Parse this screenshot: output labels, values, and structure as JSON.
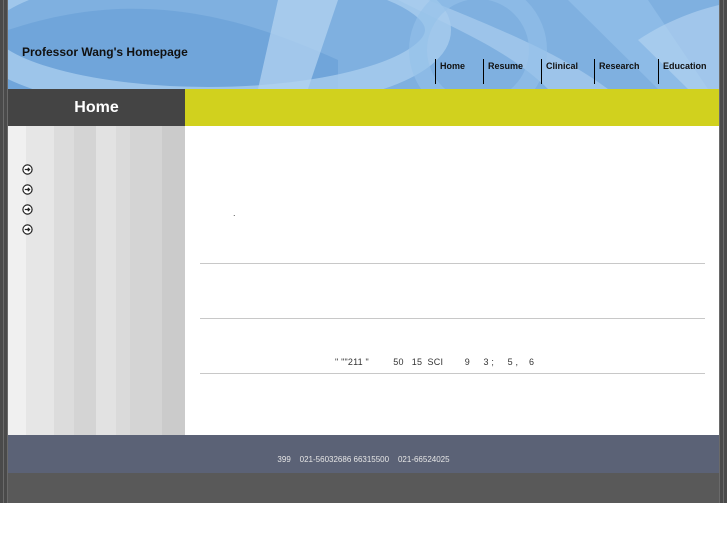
{
  "site": {
    "title": "Professor Wang's Homepage"
  },
  "nav": [
    {
      "label": "Home"
    },
    {
      "label": "Resume"
    },
    {
      "label": "Clinical"
    },
    {
      "label": "Research"
    },
    {
      "label": "Education"
    }
  ],
  "section": {
    "title": "Home"
  },
  "sidebar": {
    "link_count": 4,
    "icon": "circle-arrow-icon"
  },
  "main": {
    "dot": ".",
    "info_line": "\" \"\"211 \"         50   15  SCI        9     3 ;     5 ,    6"
  },
  "footer": {
    "text": "399    021-56032686 66315500    021-66524025"
  },
  "colors": {
    "header": "#7fb0e0",
    "accent_bar": "#d1d11e",
    "title_bar": "#444444",
    "footer": "#5b6276"
  }
}
